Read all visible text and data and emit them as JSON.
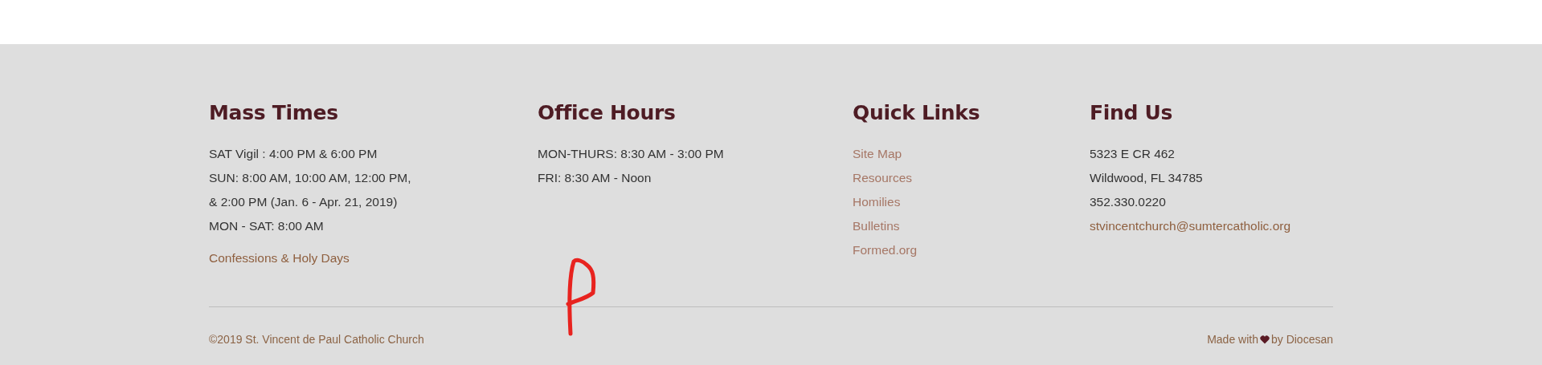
{
  "columns": [
    {
      "heading": "Mass Times",
      "items": [
        {
          "kind": "text",
          "text": "SAT Vigil : 4:00 PM & 6:00 PM"
        },
        {
          "kind": "text",
          "text": "SUN: 8:00 AM, 10:00 AM, 12:00 PM,"
        },
        {
          "kind": "text",
          "text": "& 2:00 PM (Jan. 6 - Apr. 21, 2019)"
        },
        {
          "kind": "text",
          "text": "MON - SAT: 8:00 AM"
        },
        {
          "kind": "action-link",
          "text": "Confessions & Holy Days"
        }
      ]
    },
    {
      "heading": "Office Hours",
      "items": [
        {
          "kind": "text",
          "text": "MON-THURS: 8:30 AM - 3:00 PM"
        },
        {
          "kind": "text",
          "text": "FRI: 8:30 AM - Noon"
        }
      ]
    },
    {
      "heading": "Quick Links",
      "items": [
        {
          "kind": "nav-link",
          "text": "Site Map"
        },
        {
          "kind": "nav-link",
          "text": "Resources"
        },
        {
          "kind": "nav-link",
          "text": "Homilies"
        },
        {
          "kind": "nav-link",
          "text": "Bulletins"
        },
        {
          "kind": "nav-link",
          "text": "Formed.org"
        }
      ]
    },
    {
      "heading": "Find Us",
      "items": [
        {
          "kind": "text",
          "text": "5323 E CR 462"
        },
        {
          "kind": "text",
          "text": "Wildwood, FL 34785"
        },
        {
          "kind": "text",
          "text": "352.330.0220"
        },
        {
          "kind": "email-link",
          "text": "stvincentchurch@sumtercatholic.org"
        }
      ]
    }
  ],
  "footer": {
    "copyright": "©2019 St. Vincent de Paul Catholic Church",
    "made_with": "Made with",
    "by": "by Diocesan"
  }
}
